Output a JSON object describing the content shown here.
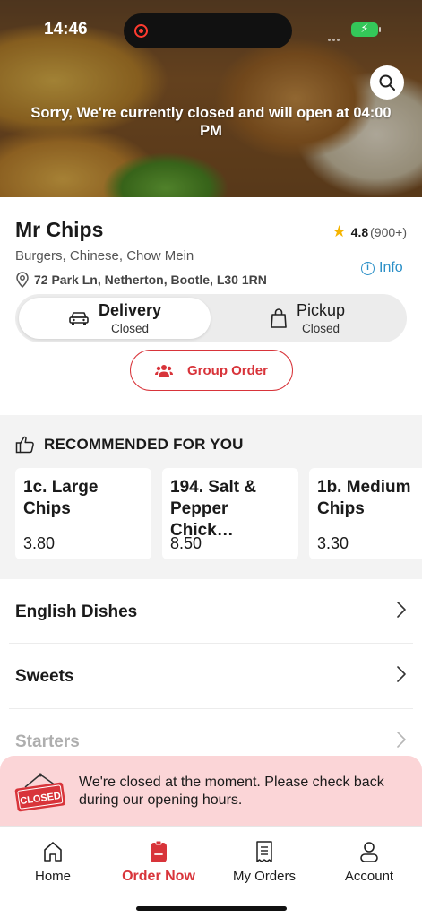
{
  "status_bar": {
    "time": "14:46"
  },
  "hero": {
    "closed_message": "Sorry, We're currently closed and will open at 04:00 PM",
    "search_icon": "search-icon"
  },
  "restaurant": {
    "name": "Mr Chips",
    "rating": "4.8",
    "rating_count": "(900+)",
    "cuisines": "Burgers, Chinese, Chow Mein",
    "address": "72 Park Ln, Netherton, Bootle, L30 1RN",
    "info_label": "Info"
  },
  "order_mode": {
    "delivery": {
      "label": "Delivery",
      "status": "Closed",
      "icon": "car-icon"
    },
    "pickup": {
      "label": "Pickup",
      "status": "Closed",
      "icon": "bag-icon"
    }
  },
  "group_order": {
    "label": "Group Order",
    "icon": "group-icon"
  },
  "recommended": {
    "title": "RECOMMENDED FOR YOU",
    "items": [
      {
        "name": "1c. Large Chips",
        "price": "3.80"
      },
      {
        "name": "194. Salt & Pepper Chick…",
        "price": "8.50"
      },
      {
        "name": "1b. Medium Chips",
        "price": "3.30"
      }
    ]
  },
  "categories": [
    {
      "label": "English Dishes"
    },
    {
      "label": "Sweets"
    },
    {
      "label": "Starters"
    }
  ],
  "closed_notice": {
    "sign_text": "CLOSED",
    "message": "We're closed at the moment. Please check back during our opening hours."
  },
  "tabs": [
    {
      "label": "Home",
      "icon": "home-icon"
    },
    {
      "label": "Order Now",
      "icon": "order-icon"
    },
    {
      "label": "My Orders",
      "icon": "receipt-icon"
    },
    {
      "label": "Account",
      "icon": "person-icon"
    }
  ],
  "colors": {
    "accent": "#d8343a",
    "link": "#2a8fc7",
    "notice_bg": "#fbd5d7",
    "star": "#f5b400"
  }
}
